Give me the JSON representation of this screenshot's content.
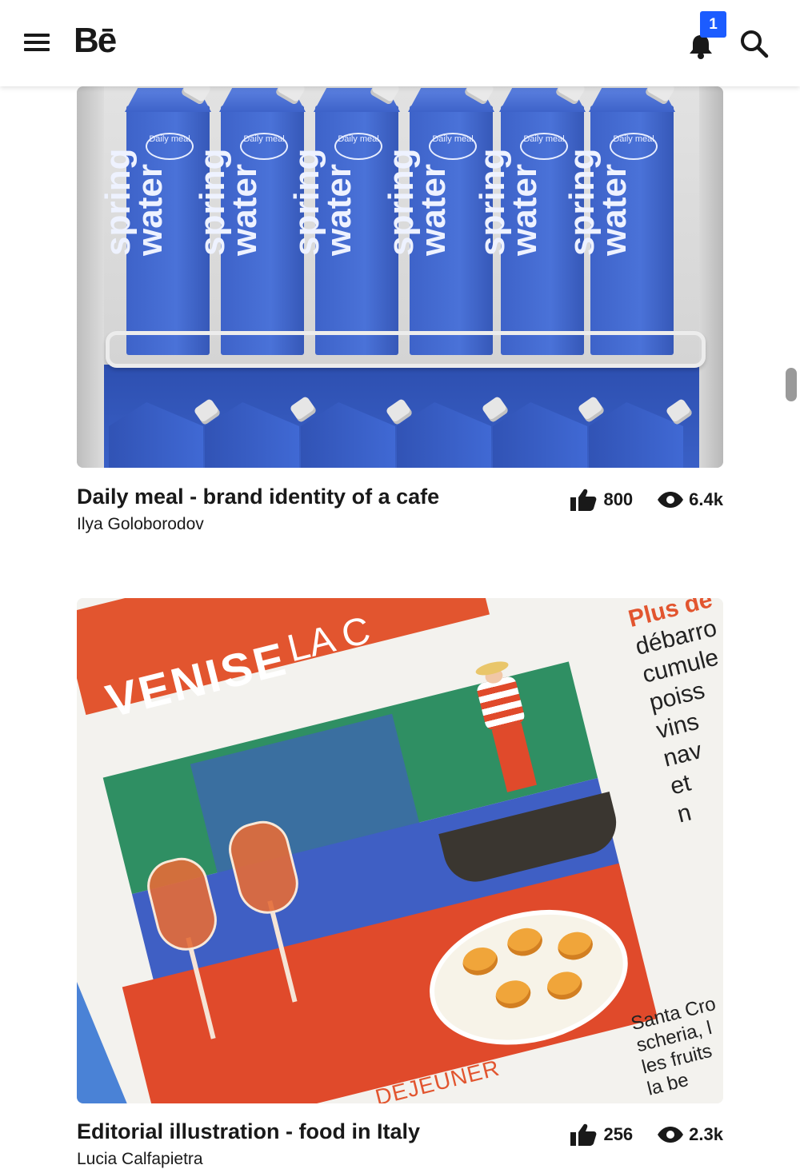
{
  "header": {
    "logo": "Bē",
    "notification_count": "1",
    "icons": [
      "hamburger-menu-icon",
      "bell-icon",
      "search-icon"
    ]
  },
  "projects": [
    {
      "title": "Daily meal - brand identity of a cafe",
      "author": "Ilya Goloborodov",
      "likes": "800",
      "views": "6.4k",
      "image": {
        "carton_brand": "Daily meal",
        "carton_text_1": "spring",
        "carton_text_2": "water"
      }
    },
    {
      "title": "Editorial illustration - food in Italy",
      "author": "Lucia Calfapietra",
      "likes": "256",
      "views": "2.3k",
      "image": {
        "headline": "VENISE",
        "headline_2": "LA C",
        "side_highlight": "Plus dé",
        "side_lines": [
          "débarro",
          "cumule",
          "poiss",
          "vins",
          "nav",
          "et",
          "n"
        ],
        "bottom_lines": [
          "Santa Cro",
          "scheria, l",
          "les fruits",
          "la be"
        ],
        "footer_word": "DÉJEUNER"
      }
    }
  ],
  "colors": {
    "accent": "#1c5cff",
    "text": "#191919",
    "carton_blue": "#4169d2"
  }
}
